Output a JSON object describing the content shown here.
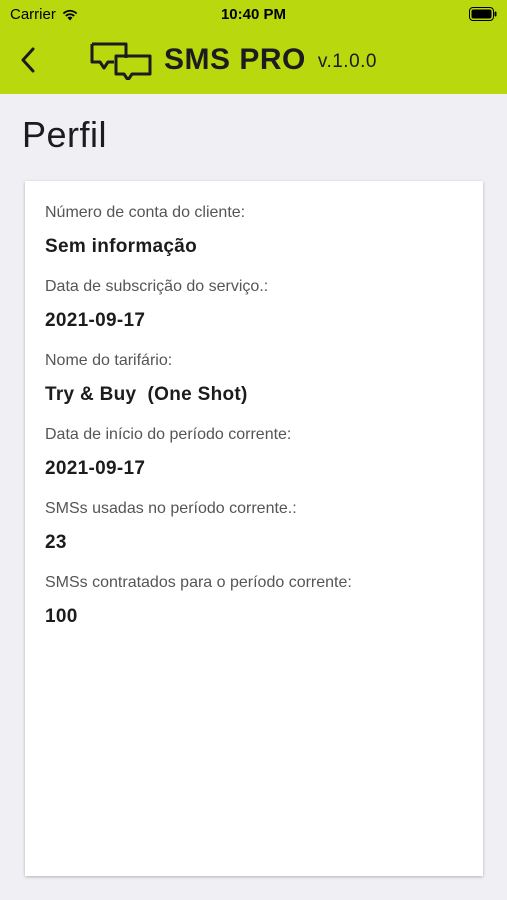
{
  "status_bar": {
    "carrier": "Carrier",
    "time": "10:40 PM",
    "icons": [
      "wifi-icon",
      "battery-icon"
    ]
  },
  "navbar": {
    "back_icon": "chevron-left-icon",
    "logo_icon": "chat-bubbles-icon",
    "app_name": "SMS PRO",
    "version": "v.1.0.0",
    "color": "#b9d80e"
  },
  "page": {
    "title": "Perfil"
  },
  "profile": {
    "fields": [
      {
        "label": "Número de conta do cliente:",
        "value": "Sem informação"
      },
      {
        "label": "Data de subscrição do serviço.:",
        "value": "2021-09-17"
      },
      {
        "label": "Nome do tarifário:",
        "value": "Try & Buy  (One Shot)"
      },
      {
        "label": "Data de início do período corrente:",
        "value": "2021-09-17"
      },
      {
        "label": "SMSs usadas no período corrente.:",
        "value": "23"
      },
      {
        "label": "SMSs contratados para o período corrente:",
        "value": "100"
      }
    ]
  }
}
